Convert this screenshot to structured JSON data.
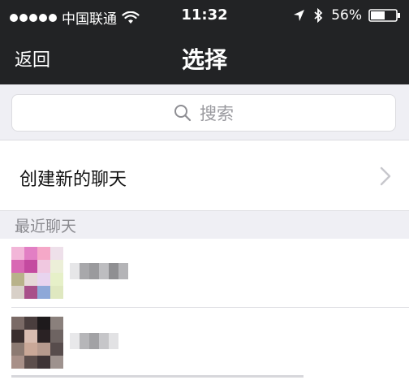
{
  "status_bar": {
    "carrier": "中国联通",
    "time": "11:32",
    "battery": "56%"
  },
  "nav": {
    "back_label": "返回",
    "title": "选择"
  },
  "search": {
    "placeholder": "搜索"
  },
  "new_chat": {
    "label": "创建新的聊天"
  },
  "recent": {
    "section_title": "最近聊天",
    "items": [
      {
        "avatar": "blurred",
        "name": "blurred"
      },
      {
        "avatar": "blurred",
        "name": "blurred"
      }
    ]
  },
  "colors": {
    "header_bg": "#222325",
    "page_bg": "#efeff4",
    "separator": "#dcdce0",
    "section_text": "#8a8a8f"
  }
}
